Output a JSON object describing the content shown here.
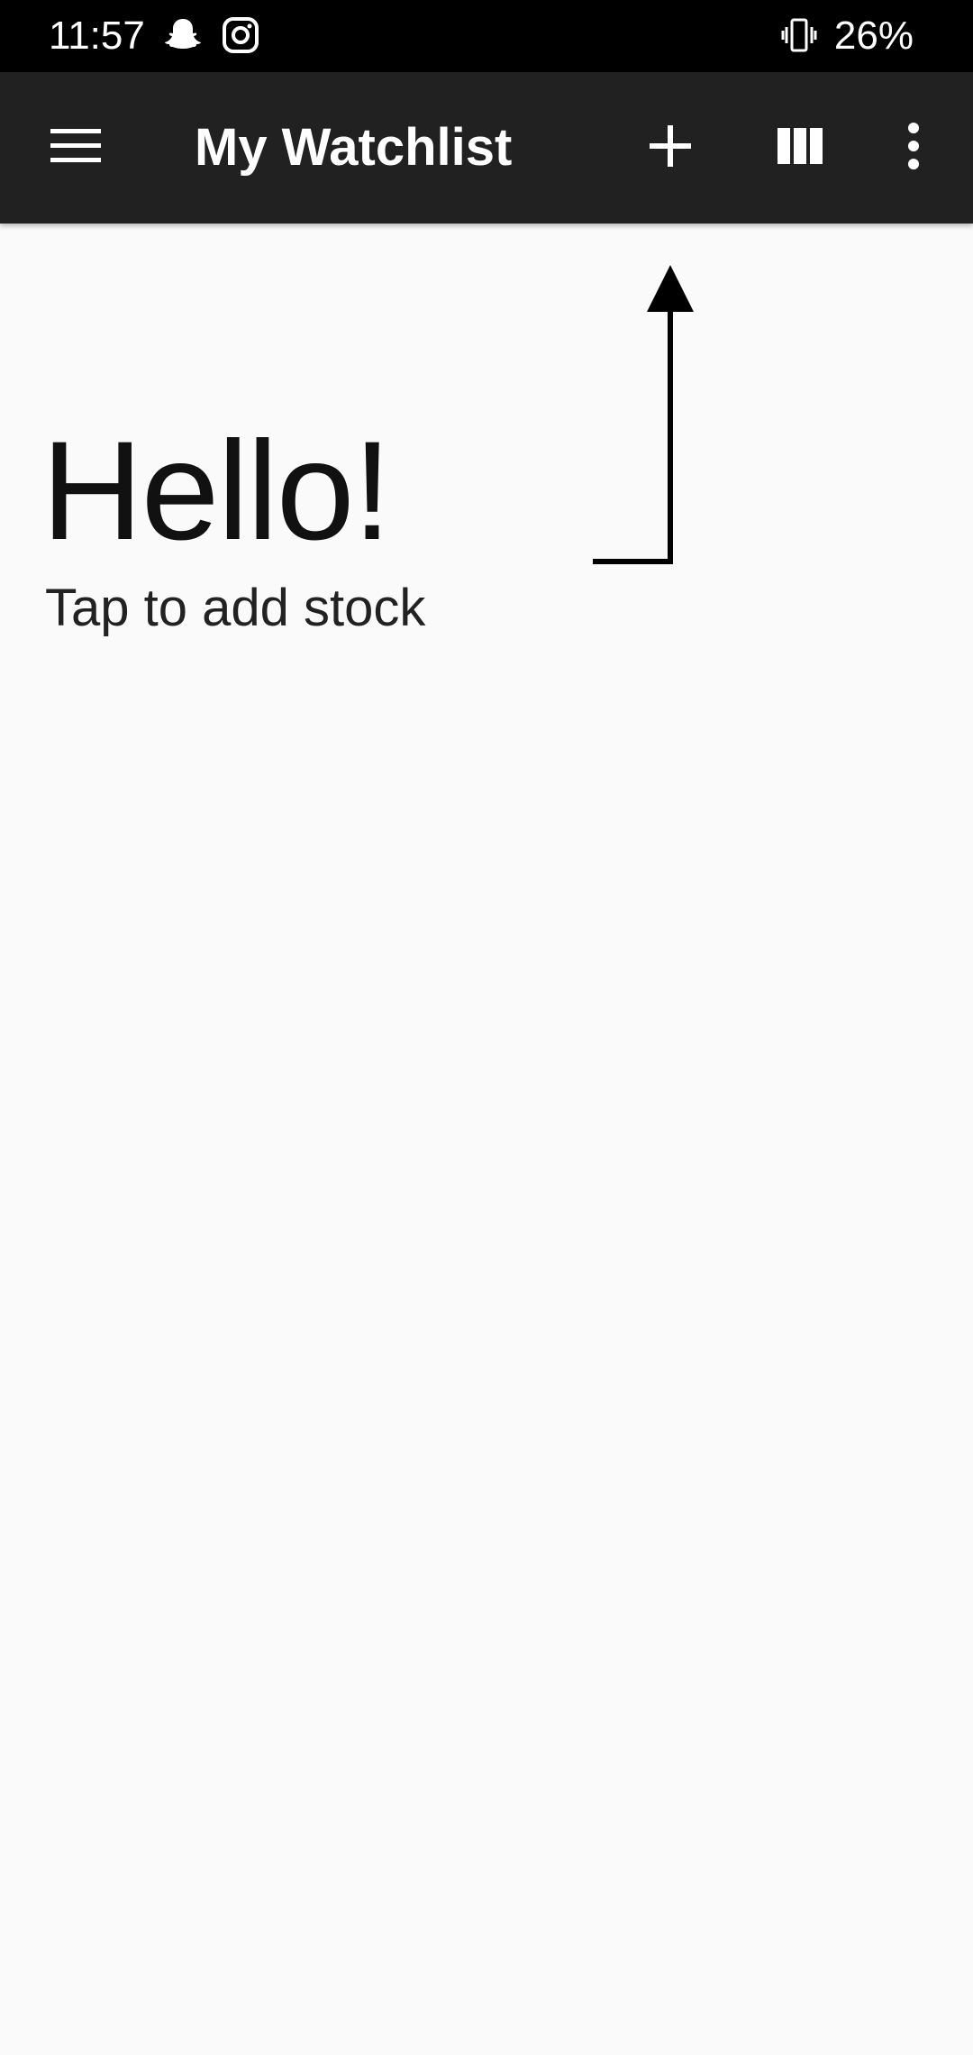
{
  "status_bar": {
    "time": "11:57",
    "battery": "26%",
    "icons": [
      "snapchat-icon",
      "instagram-icon",
      "vibrate-icon"
    ]
  },
  "app_bar": {
    "title": "My Watchlist",
    "icons": [
      "menu-icon",
      "add-icon",
      "columns-icon",
      "more-vert-icon"
    ],
    "background": "#212121"
  },
  "content": {
    "greeting": "Hello!",
    "hint": "Tap to add stock",
    "background": "#fafafa"
  }
}
